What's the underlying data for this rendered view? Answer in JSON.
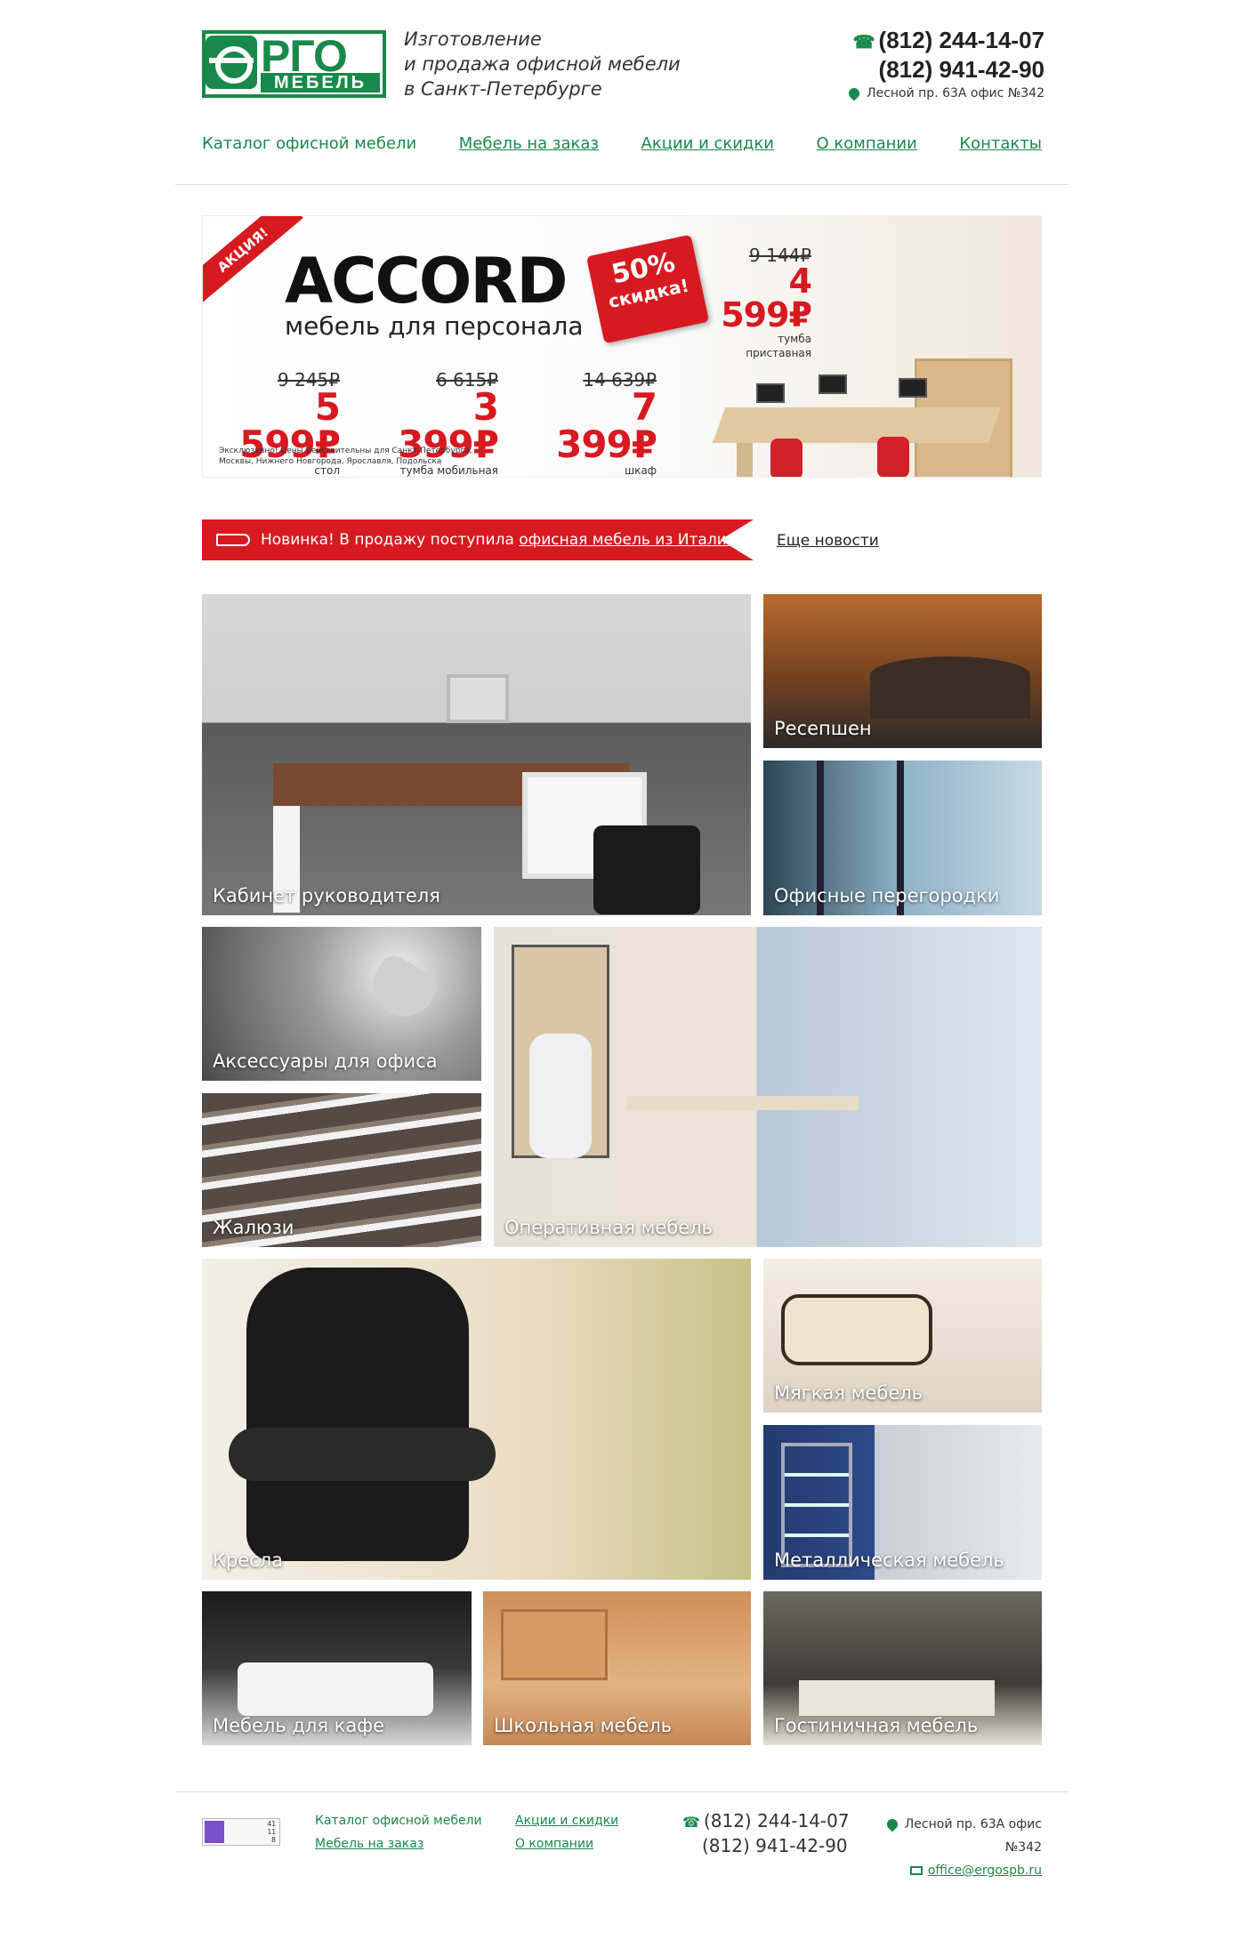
{
  "header": {
    "logo_text_main": "РГО",
    "logo_text_sub": "МЕБЕЛЬ",
    "tagline_line1": "Изготовление",
    "tagline_line2": "и продажа офисной мебели",
    "tagline_line3": "в Санкт-Петербурге",
    "phone1": "(812) 244-14-07",
    "phone2": "(812) 941-42-90",
    "address": "Лесной пр. 63А офис №342"
  },
  "nav": {
    "items": [
      {
        "label": "Каталог офисной мебели"
      },
      {
        "label": "Мебель на заказ"
      },
      {
        "label": "Акции и скидки"
      },
      {
        "label": "О компании"
      },
      {
        "label": "Контакты"
      }
    ]
  },
  "banner": {
    "ribbon": "АКЦИЯ!",
    "title": "ACCORD",
    "subtitle": "мебель для персонала",
    "badge_percent": "50%",
    "badge_text": "скидка!",
    "prices": [
      {
        "old": "9 245₽",
        "new": "5 599₽",
        "caption": "стол"
      },
      {
        "old": "6 615₽",
        "new": "3 399₽",
        "caption": "тумба мобильная"
      },
      {
        "old": "14 639₽",
        "new": "7 399₽",
        "caption": "шкаф"
      },
      {
        "old": "9 144₽",
        "new": "4 599₽",
        "caption": "тумба приставная"
      }
    ],
    "note": "Эксклюзивно! Цены действительны для Санкт-Петербурга, Москвы, Нижнего Новгорода, Ярославля, Подольска"
  },
  "news": {
    "prefix": "Новинка! В продажу поступила",
    "link": "офисная мебель из Италии",
    "more": "Еще новости"
  },
  "tiles": {
    "kab": "Кабинет руководителя",
    "res": "Ресепшен",
    "per": "Офисные перегородки",
    "acc": "Аксессуары для офиса",
    "zhal": "Жалюзи",
    "oper": "Оперативная мебель",
    "kres": "Кресла",
    "myag": "Мягкая мебель",
    "met": "Металлическая мебель",
    "kafe": "Мебель для кафе",
    "shk": "Школьная мебель",
    "gost": "Гостиничная мебель"
  },
  "footer": {
    "counter": [
      "41",
      "11",
      "8"
    ],
    "col1": [
      "Каталог офисной мебели",
      "Мебель на заказ"
    ],
    "col2": [
      "Акции и скидки",
      "О компании"
    ],
    "phone1": "(812) 244-14-07",
    "phone2": "(812) 941-42-90",
    "address": "Лесной пр. 63А офис №342",
    "email": "office@ergospb.ru"
  },
  "colors": {
    "brand_green": "#18894a",
    "accent_red": "#d71920"
  }
}
